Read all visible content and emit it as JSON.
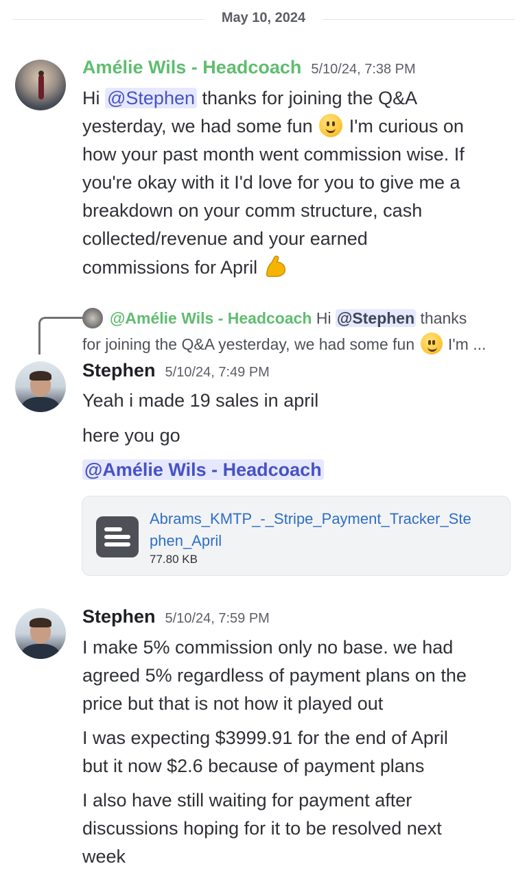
{
  "date_divider": {
    "label": "May 10, 2024"
  },
  "messages": [
    {
      "author": "Amélie Wils - Headcoach",
      "timestamp": "5/10/24, 7:38 PM",
      "lines": {
        "l1_pre": "Hi ",
        "l1_mention": "@Stephen",
        "l1_post": " thanks for joining the Q&A",
        "l2_pre": "yesterday, we had some fun ",
        "l2_post": " I'm curious on",
        "l3": "how your past month went commission wise. If",
        "l4": "you're okay with it I'd love for you to give me a",
        "l5": "breakdown on your comm structure, cash",
        "l6": "collected/revenue and your earned",
        "l7": "commissions for April "
      }
    },
    {
      "reply_to": {
        "author": "@Amélie Wils - Headcoach",
        "text_pre": " Hi ",
        "mention": "@Stephen",
        "text_post": " thanks",
        "line2_pre": "for joining the Q&A yesterday, we had some fun ",
        "line2_post": " I'm ..."
      },
      "author": "Stephen",
      "timestamp": "5/10/24, 7:49 PM",
      "lines": {
        "l1": "Yeah i made 19 sales in april",
        "l2": "here you go",
        "l3_mention": "@Amélie Wils - Headcoach"
      },
      "attachment": {
        "name": "Abrams_KMTP_-_Stripe_Payment_Tracker_Stephen_April",
        "size": "77.80 KB",
        "icon": "document-icon"
      }
    },
    {
      "author": "Stephen",
      "timestamp": "5/10/24, 7:59 PM",
      "lines": {
        "l1": "I make 5% commission only no base. we had",
        "l2": "agreed 5% regardless of payment plans on the",
        "l3": "price but that is not how it played out",
        "l4": "I was expecting $3999.91 for the end of April",
        "l5": "but it now $2.6 because of payment plans",
        "l6": "I also have still waiting for payment after",
        "l7": "discussions hoping for it to be resolved next",
        "l8": "week"
      }
    }
  ],
  "colors": {
    "author_green": "#5fbd6f",
    "mention_bg": "#e6e8fd",
    "mention_text": "#4752c4",
    "link_blue": "#2e6ec7"
  }
}
